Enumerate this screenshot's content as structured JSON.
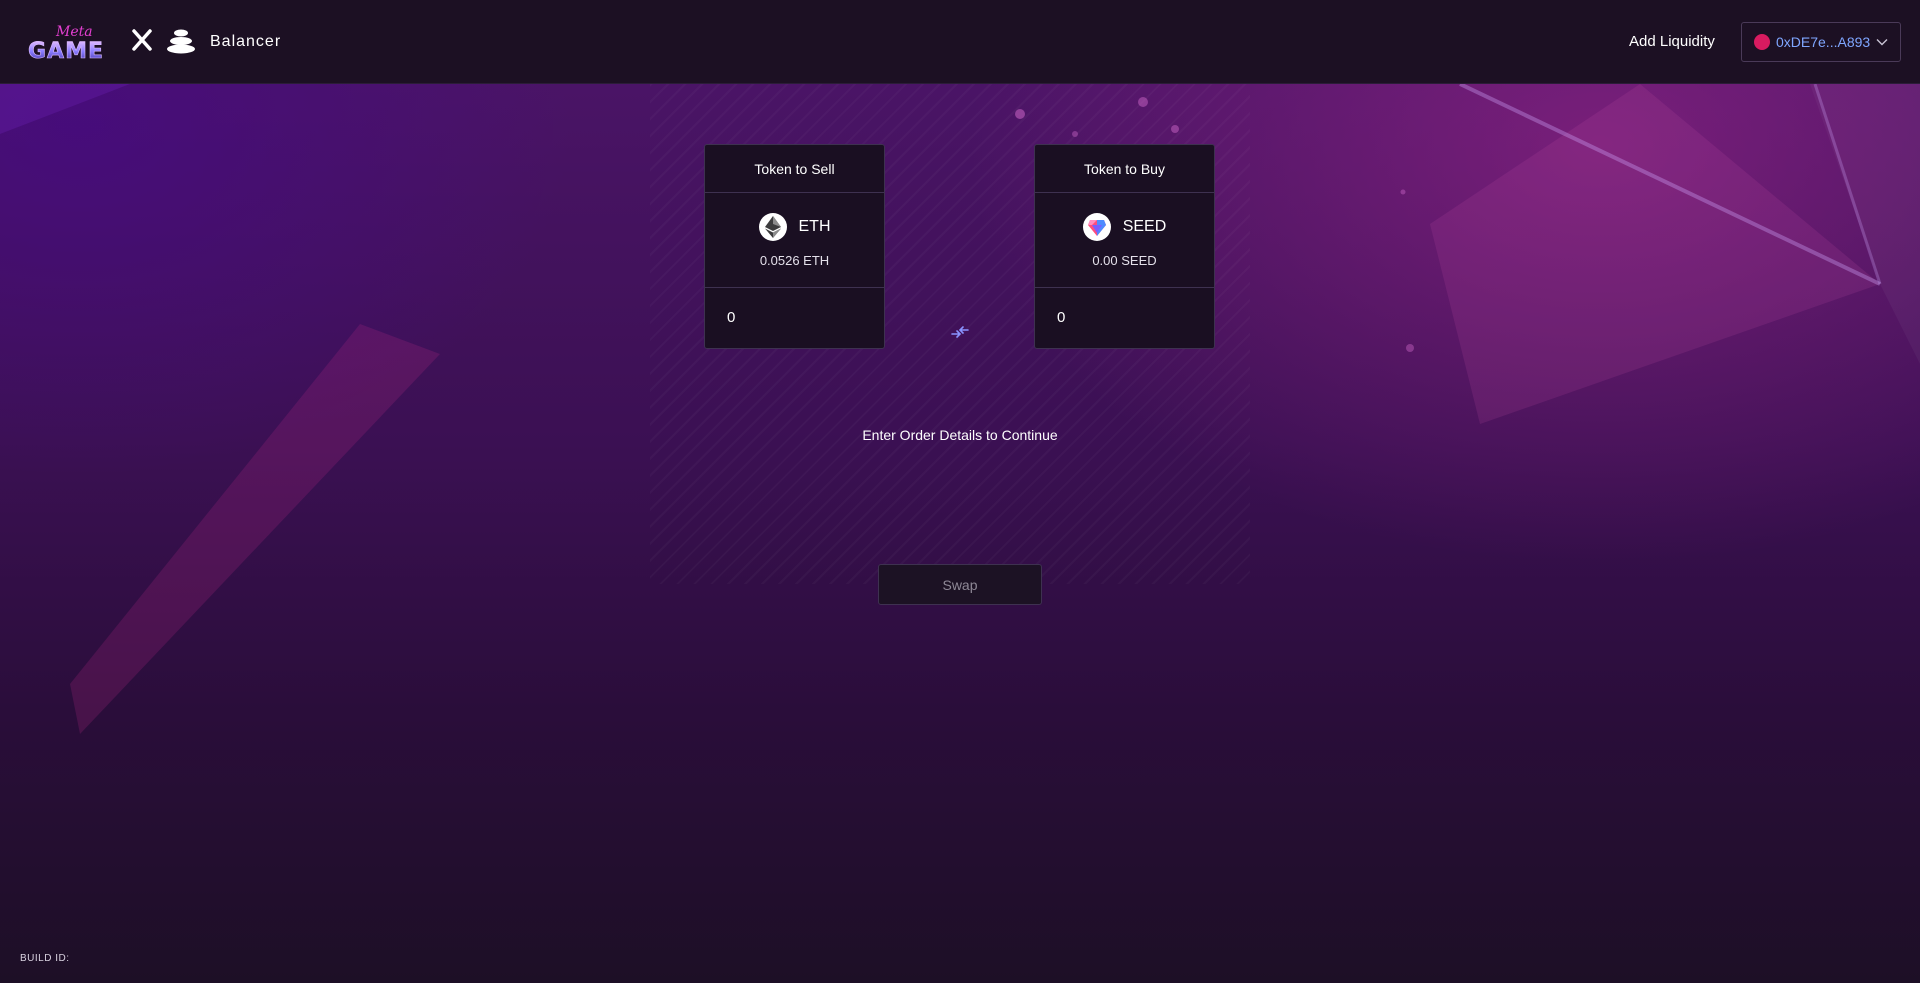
{
  "header": {
    "brand_name": "Balancer",
    "logo_text_top": "Meta",
    "logo_text_main": "GAME",
    "add_liquidity_label": "Add Liquidity",
    "account_address": "0xDE7e...A893"
  },
  "swap": {
    "sell_card": {
      "title": "Token to Sell",
      "token_symbol": "ETH",
      "token_icon": "ethereum-icon",
      "balance": "0.0526 ETH",
      "amount_value": "0"
    },
    "buy_card": {
      "title": "Token to Buy",
      "token_symbol": "SEED",
      "token_icon": "seed-gem-icon",
      "balance": "0.00 SEED",
      "amount_value": "0"
    },
    "status_text": "Enter Order Details to Continue",
    "swap_button_label": "Swap"
  },
  "footer": {
    "build_id_label": "BUILD ID:"
  },
  "colors": {
    "header_bg": "#1c1023",
    "card_bg": "#1a0f22",
    "account_text": "#7fa6ff",
    "avatar": "#d81b60",
    "swap_arrows": "#7f8cff"
  }
}
